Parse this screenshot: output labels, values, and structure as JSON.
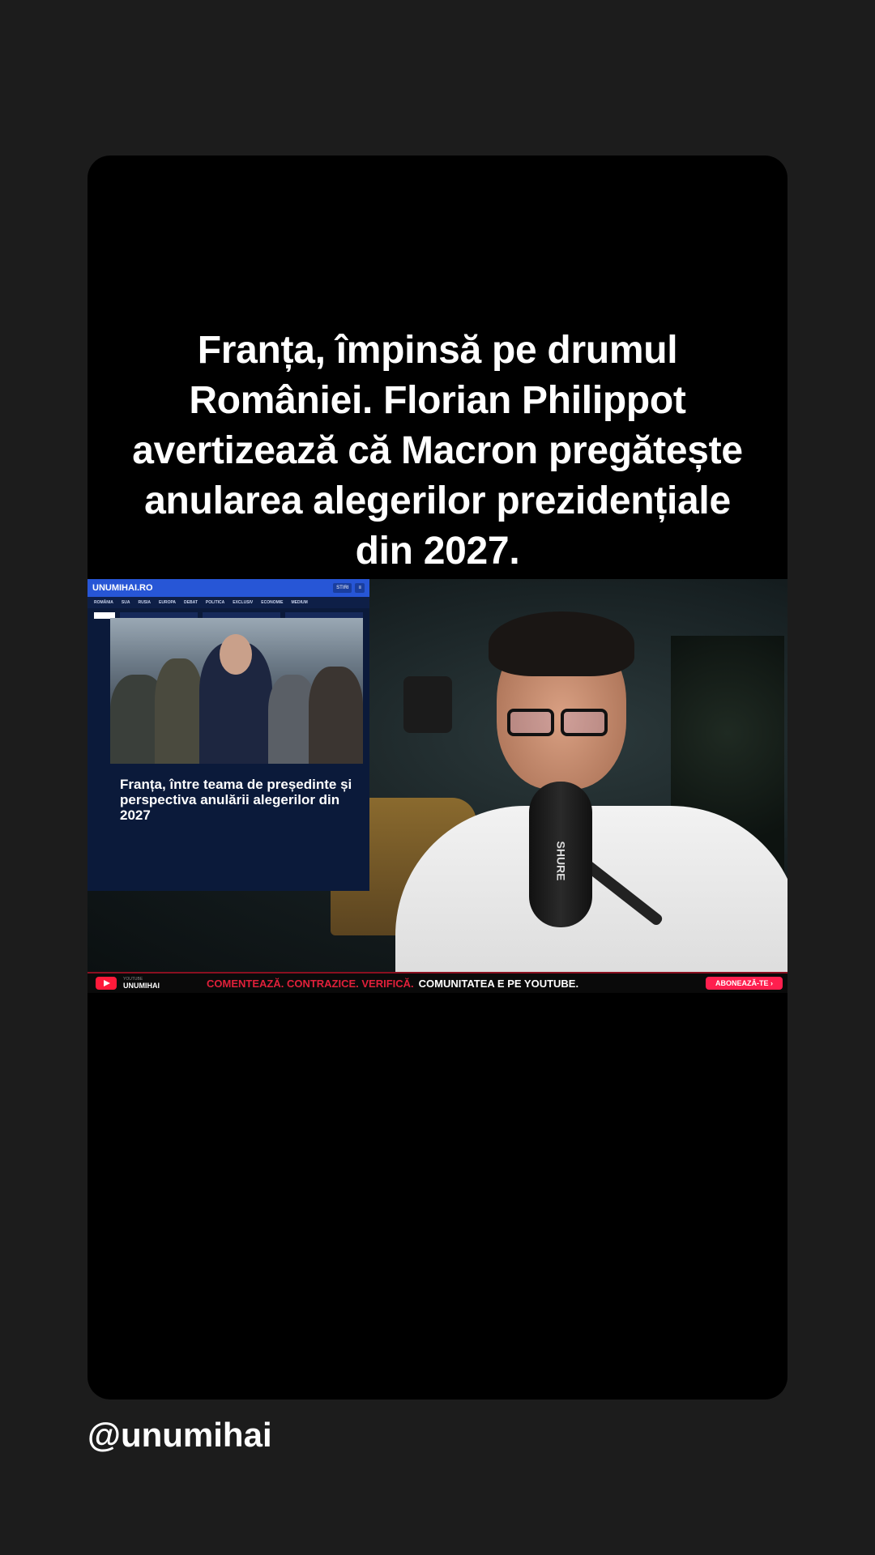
{
  "post": {
    "headline": "Franța, împinsă pe drumul României. Florian Philippot avertizează că Macron pregătește anularea alegerilor prezidențiale din 2027.",
    "handle": "@unumihai"
  },
  "video": {
    "mic_brand": "SHURE",
    "article": {
      "site": "UNUMIHAI.RO",
      "top_buttons": [
        "STIRI",
        "≡"
      ],
      "nav": [
        "ROMÂNIA",
        "SUA",
        "RUSIA",
        "EUROPA",
        "DEBAT",
        "POLITICA",
        "EXCLUSIV",
        "ECONOMIE",
        "MEDIUM"
      ],
      "title": "Franța, între teama de președinte și perspectiva anulării alegerilor din 2027"
    },
    "ticker": {
      "channel_small": "YOUTUBE",
      "channel_name": "UNUMIHAI",
      "red_text": "COMENTEAZĂ. CONTRAZICE. VERIFICĂ.",
      "white_text": "COMUNITATEA E PE YOUTUBE.",
      "subscribe_label": "ABONEAZĂ-TE ›"
    }
  },
  "colors": {
    "background": "#1c1c1c",
    "card": "#000000",
    "accent_red": "#e0203a",
    "site_blue": "#2756d6",
    "subscribe": "#ff1f4e"
  }
}
